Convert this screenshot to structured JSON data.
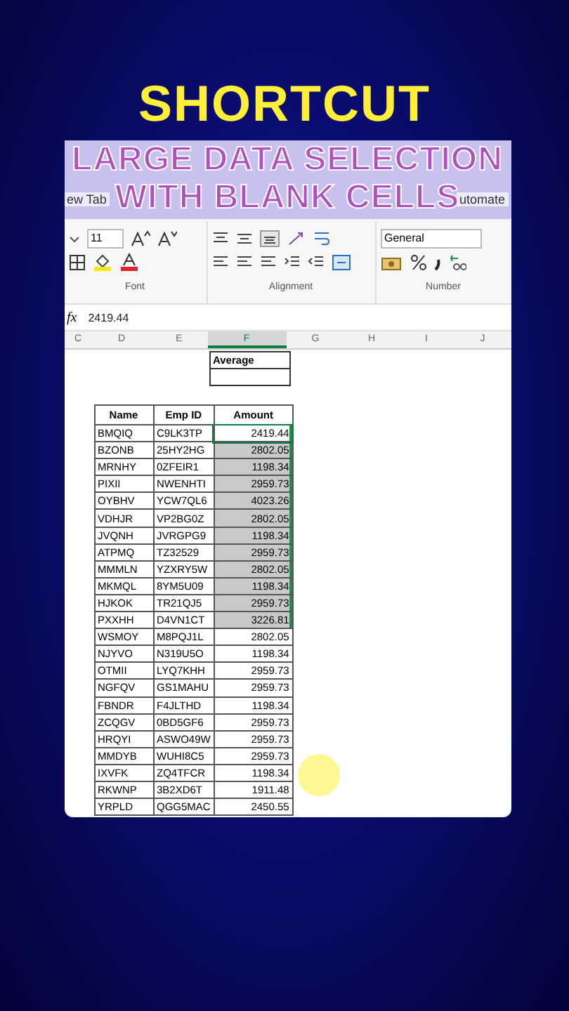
{
  "headline": "SHORTCUT",
  "banner": {
    "lines": [
      "LARGE DATA SELECTION",
      "WITH BLANK CELLS"
    ]
  },
  "tabs": [
    {
      "label": "ew Tab",
      "selected": false
    },
    {
      "label": "utomate",
      "selected": false
    }
  ],
  "ribbon": {
    "font_size": "11",
    "number_format": "General",
    "groups": [
      "Font",
      "Alignment",
      "Number"
    ]
  },
  "formula_bar": {
    "fx": "fx",
    "value": "2419.44"
  },
  "column_headers": [
    {
      "label": "C",
      "selected": false
    },
    {
      "label": "D",
      "selected": false
    },
    {
      "label": "E",
      "selected": false
    },
    {
      "label": "F",
      "selected": true
    },
    {
      "label": "G",
      "selected": false
    },
    {
      "label": "H",
      "selected": false
    },
    {
      "label": "I",
      "selected": false
    },
    {
      "label": "J",
      "selected": false
    }
  ],
  "average_box": {
    "label": "Average"
  },
  "table": {
    "columns": [
      "Name",
      "Emp ID",
      "Amount"
    ],
    "rows": [
      {
        "name": "BMQIQ",
        "emp_id": "C9LK3TP",
        "amount": "2419.44",
        "selected": true,
        "active": true
      },
      {
        "name": "BZONB",
        "emp_id": "25HY2HG",
        "amount": "2802.05",
        "selected": true,
        "active": false
      },
      {
        "name": "MRNHY",
        "emp_id": "0ZFEIR1",
        "amount": "1198.34",
        "selected": true,
        "active": false
      },
      {
        "name": "PIXII",
        "emp_id": "NWENHTI",
        "amount": "2959.73",
        "selected": true,
        "active": false
      },
      {
        "name": "OYBHV",
        "emp_id": "YCW7QL6",
        "amount": "4023.26",
        "selected": true,
        "active": false
      },
      {
        "name": "VDHJR",
        "emp_id": "VP2BG0Z",
        "amount": "2802.05",
        "selected": true,
        "active": false
      },
      {
        "name": "JVQNH",
        "emp_id": "JVRGPG9",
        "amount": "1198.34",
        "selected": true,
        "active": false
      },
      {
        "name": "ATPMQ",
        "emp_id": "TZ32529",
        "amount": "2959.73",
        "selected": true,
        "active": false
      },
      {
        "name": "MMMLN",
        "emp_id": "YZXRY5W",
        "amount": "2802.05",
        "selected": true,
        "active": false
      },
      {
        "name": "MKMQL",
        "emp_id": "8YM5U09",
        "amount": "1198.34",
        "selected": true,
        "active": false
      },
      {
        "name": "HJKOK",
        "emp_id": "TR21QJ5",
        "amount": "2959.73",
        "selected": true,
        "active": false
      },
      {
        "name": "PXXHH",
        "emp_id": "D4VN1CT",
        "amount": "3226.81",
        "selected": true,
        "active": false
      },
      {
        "name": "WSMOY",
        "emp_id": "M8PQJ1L",
        "amount": "2802.05",
        "selected": false,
        "active": false
      },
      {
        "name": "NJYVO",
        "emp_id": "N319U5O",
        "amount": "1198.34",
        "selected": false,
        "active": false
      },
      {
        "name": "OTMII",
        "emp_id": "LYQ7KHH",
        "amount": "2959.73",
        "selected": false,
        "active": false
      },
      {
        "name": "NGFQV",
        "emp_id": "GS1MAHU",
        "amount": "2959.73",
        "selected": false,
        "active": false
      },
      {
        "name": "FBNDR",
        "emp_id": "F4JLTHD",
        "amount": "1198.34",
        "selected": false,
        "active": false
      },
      {
        "name": "ZCQGV",
        "emp_id": "0BD5GF6",
        "amount": "2959.73",
        "selected": false,
        "active": false
      },
      {
        "name": "HRQYI",
        "emp_id": "ASWO49W",
        "amount": "2959.73",
        "selected": false,
        "active": false
      },
      {
        "name": "MMDYB",
        "emp_id": "WUHI8C5",
        "amount": "2959.73",
        "selected": false,
        "active": false
      },
      {
        "name": "IXVFK",
        "emp_id": "ZQ4TFCR",
        "amount": "1198.34",
        "selected": false,
        "active": false
      },
      {
        "name": "RKWNP",
        "emp_id": "3B2XD6T",
        "amount": "1911.48",
        "selected": false,
        "active": false
      },
      {
        "name": "YRPLD",
        "emp_id": "QGG5MAC",
        "amount": "2450.55",
        "selected": false,
        "active": false
      }
    ]
  }
}
